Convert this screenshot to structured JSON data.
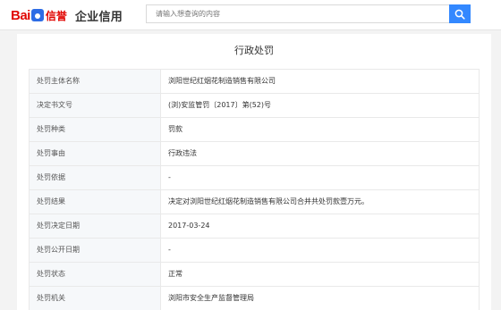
{
  "header": {
    "logo_bai": "Bai",
    "logo_xin": "信誉",
    "logo_qy": "企业信用",
    "search_placeholder": "请输入想查询的内容"
  },
  "panel": {
    "title": "行政处罚",
    "rows": [
      {
        "label": "处罚主体名称",
        "value": "浏阳世纪红烟花制造销售有限公司"
      },
      {
        "label": "决定书文号",
        "value": "(浏)安监管罚〔2017〕第(52)号"
      },
      {
        "label": "处罚种类",
        "value": "罚款"
      },
      {
        "label": "处罚事由",
        "value": "行政违法"
      },
      {
        "label": "处罚依据",
        "value": "-"
      },
      {
        "label": "处罚结果",
        "value": "决定对浏阳世纪红烟花制造销售有限公司合并共处罚款壹万元。"
      },
      {
        "label": "处罚决定日期",
        "value": "2017-03-24"
      },
      {
        "label": "处罚公开日期",
        "value": "-"
      },
      {
        "label": "处罚状态",
        "value": "正常"
      },
      {
        "label": "处罚机关",
        "value": "浏阳市安全生产监督管理局"
      }
    ]
  },
  "colors": {
    "accent": "#3388ff",
    "brand_red": "#e10602",
    "brand_blue": "#2d6ce5"
  }
}
